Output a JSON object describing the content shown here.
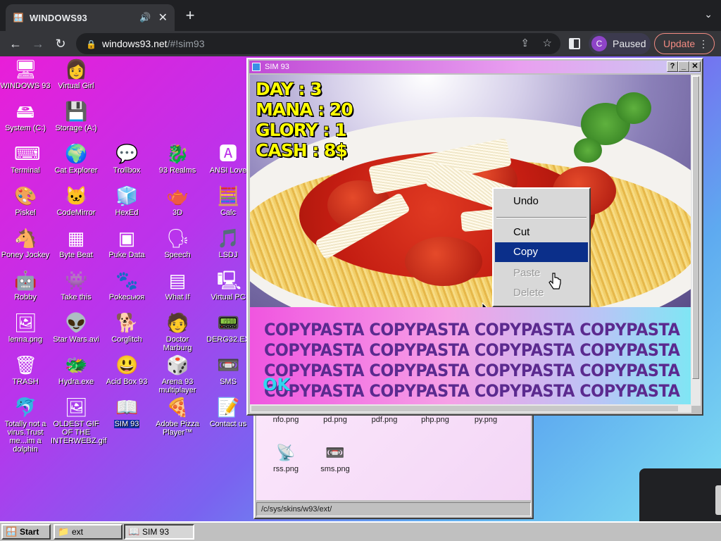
{
  "browser": {
    "tab_title": "WINDOWS93",
    "new_tab": "+",
    "url_host": "windows93.net",
    "url_path": "/#!sim93",
    "profile_initial": "C",
    "profile_status": "Paused",
    "update_label": "Update"
  },
  "desktop": {
    "icons": [
      {
        "label": "WINDOWS 93",
        "icon": "computer-icon",
        "glyph": "🖥"
      },
      {
        "label": "Virtual Girl",
        "icon": "face-icon",
        "glyph": "👩"
      },
      {
        "label": "System (C:)",
        "icon": "drive-icon",
        "glyph": "🖴"
      },
      {
        "label": "Storage (A:)",
        "icon": "floppy-drive-icon",
        "glyph": "💾"
      },
      {
        "label": "Terminal",
        "icon": "terminal-icon",
        "glyph": "⌨"
      },
      {
        "label": "Cat Explorer",
        "icon": "globe-icon",
        "glyph": "🌍"
      },
      {
        "label": "Trollbox",
        "icon": "chat-icon",
        "glyph": "💬"
      },
      {
        "label": "93 Realms",
        "icon": "realms-icon",
        "glyph": "🐉"
      },
      {
        "label": "ANSI Love",
        "icon": "ansi-icon",
        "glyph": "🅰"
      },
      {
        "label": "Piskel",
        "icon": "palette-icon",
        "glyph": "🎨"
      },
      {
        "label": "CodeMirror",
        "icon": "codemirror-icon",
        "glyph": "🐱"
      },
      {
        "label": "HexEd",
        "icon": "cube-icon",
        "glyph": "🧊"
      },
      {
        "label": "3D",
        "icon": "teapot-icon",
        "glyph": "🫖"
      },
      {
        "label": "Calc",
        "icon": "calculator-icon",
        "glyph": "🧮"
      },
      {
        "label": "Poney Jockey",
        "icon": "pony-icon",
        "glyph": "🐴"
      },
      {
        "label": "Byte Beat",
        "icon": "bytebeat-icon",
        "glyph": "▦"
      },
      {
        "label": "Puke Data",
        "icon": "pd-icon",
        "glyph": "▣"
      },
      {
        "label": "Speech",
        "icon": "speech-icon",
        "glyph": "🗣"
      },
      {
        "label": "LSDJ",
        "icon": "lsdj-icon",
        "glyph": "🎵"
      },
      {
        "label": "Robby",
        "icon": "robot-icon",
        "glyph": "🤖"
      },
      {
        "label": "Take this",
        "icon": "take-this-icon",
        "glyph": "👾"
      },
      {
        "label": "Pokeсьюя",
        "icon": "pokemon-icon",
        "glyph": "🐾"
      },
      {
        "label": "What If",
        "icon": "what-if-icon",
        "glyph": "▤"
      },
      {
        "label": "Virtual PC",
        "icon": "virtual-pc-icon",
        "glyph": "🖳"
      },
      {
        "label": "lenna.png",
        "icon": "image-file-icon",
        "glyph": "🖼"
      },
      {
        "label": "Star Wars.avi",
        "icon": "yoda-icon",
        "glyph": "👽"
      },
      {
        "label": "Corglitch",
        "icon": "corgi-icon",
        "glyph": "🐕"
      },
      {
        "label": "Doctor Marburg",
        "icon": "doctor-icon",
        "glyph": "🧑"
      },
      {
        "label": "DERG32.EX",
        "icon": "derg-icon",
        "glyph": "📟"
      },
      {
        "label": "TRASH",
        "icon": "trash-icon",
        "glyph": "🗑"
      },
      {
        "label": "Hydra.exe",
        "icon": "hydra-icon",
        "glyph": "🐲"
      },
      {
        "label": "Acid Box 93",
        "icon": "smiley-icon",
        "glyph": "😃"
      },
      {
        "label": "Arena 93 multiplayer",
        "icon": "arena-icon",
        "glyph": "🎲"
      },
      {
        "label": "SMS",
        "icon": "sms-icon",
        "glyph": "📼"
      },
      {
        "label": "Totally not a virus.Trust me...im a dolphin",
        "icon": "dolphin-icon",
        "glyph": "🐬"
      },
      {
        "label": "OLDEST GIF OF THE INTERWEBZ.gif",
        "icon": "gif-file-icon",
        "glyph": "🖼"
      },
      {
        "label": "SIM 93",
        "icon": "sim93-icon",
        "glyph": "📖",
        "selected": true
      },
      {
        "label": "Adobe Pizza Player™",
        "icon": "pizza-icon",
        "glyph": "🍕"
      },
      {
        "label": "Contact us",
        "icon": "contact-icon",
        "glyph": "📝"
      }
    ]
  },
  "explorer": {
    "files": [
      {
        "label": "nfo.png",
        "icon": "png-file-icon"
      },
      {
        "label": "pd.png",
        "icon": "png-file-icon"
      },
      {
        "label": "pdf.png",
        "icon": "png-file-icon"
      },
      {
        "label": "php.png",
        "icon": "png-file-icon"
      },
      {
        "label": "py.png",
        "icon": "png-file-icon"
      },
      {
        "label": "rss.png",
        "icon": "rss-icon"
      },
      {
        "label": "sms.png",
        "icon": "sms-icon"
      }
    ],
    "status_path": "/c/sys/skins/w93/ext/"
  },
  "sim93": {
    "title": "SIM 93",
    "help_btn": "?",
    "stats": {
      "day": "DAY : 3",
      "mana": "MANA : 20",
      "glory": "GLORY : 1",
      "cash": "CASH : 8$"
    },
    "context_menu": {
      "items": [
        "Undo",
        "Cut",
        "Copy",
        "Paste",
        "Delete"
      ],
      "selected": "Copy"
    },
    "copypasta_line": "COPYPASTA COPYPASTA COPYPASTA COPYPASTA",
    "ok_label": "OK"
  },
  "taskbar": {
    "start_label": "Start",
    "items": [
      {
        "label": "ext",
        "icon": "folder-icon"
      },
      {
        "label": "SIM 93",
        "icon": "sim93-icon"
      }
    ]
  },
  "colors": {
    "stat_text": "#ffff00",
    "copypasta_text": "#5b2a8f",
    "menu_highlight": "#0b2f8a"
  }
}
